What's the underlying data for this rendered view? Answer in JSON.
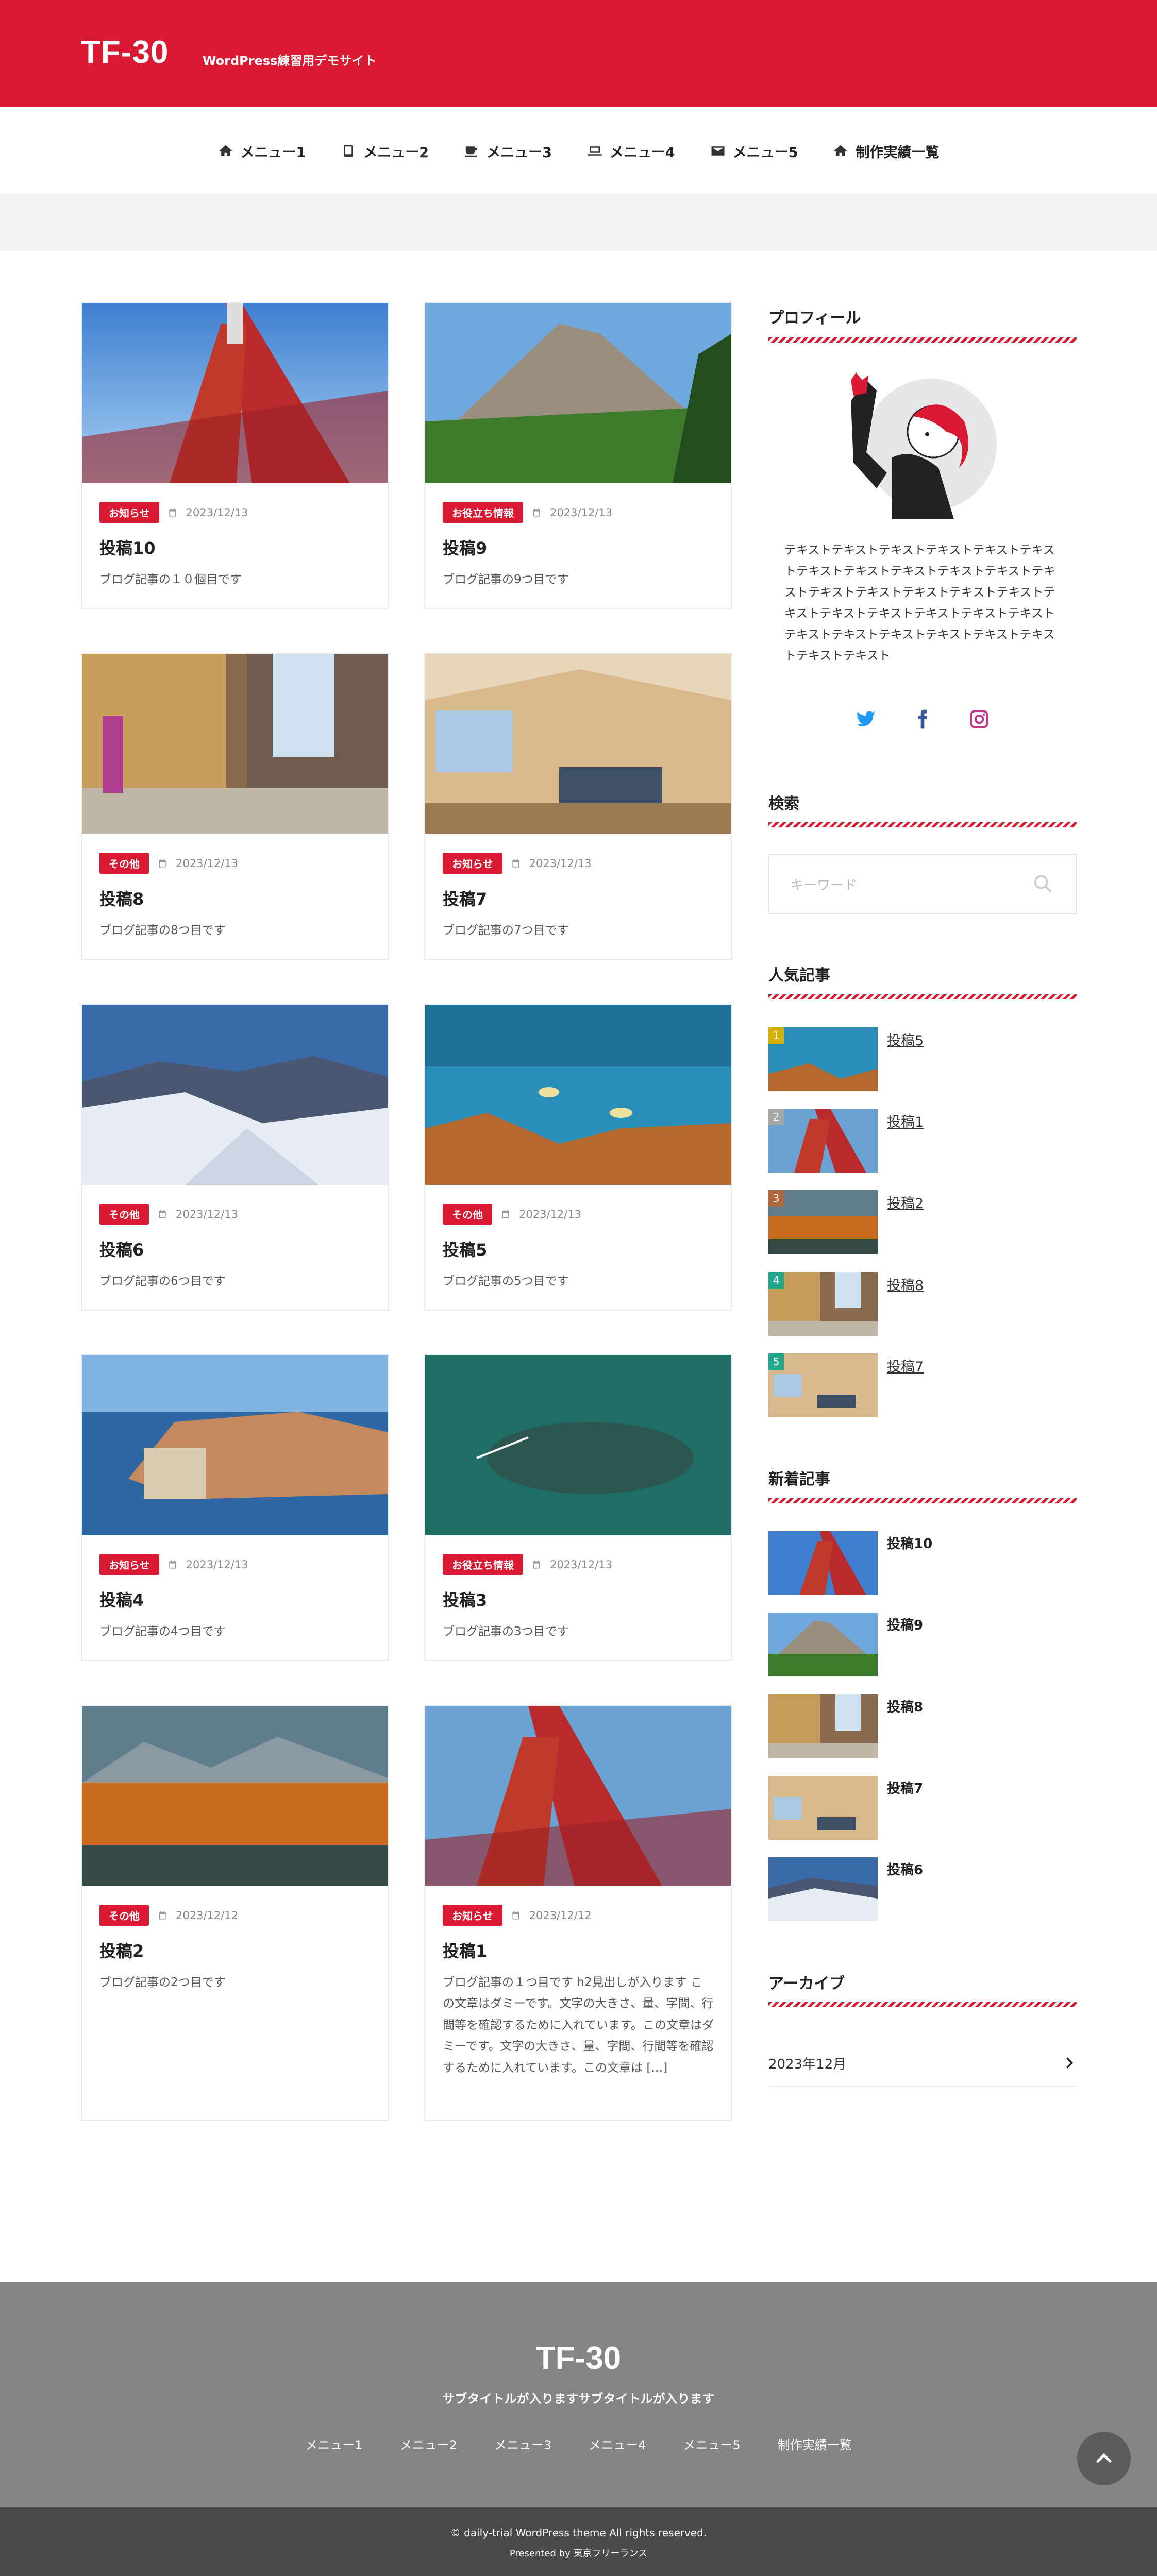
{
  "header": {
    "logo": "TF-30",
    "tagline": "WordPress練習用デモサイト"
  },
  "nav": [
    {
      "label": "メニュー1",
      "icon": "home-icon"
    },
    {
      "label": "メニュー2",
      "icon": "book-icon"
    },
    {
      "label": "メニュー3",
      "icon": "coffee-icon"
    },
    {
      "label": "メニュー4",
      "icon": "laptop-icon"
    },
    {
      "label": "メニュー5",
      "icon": "envelope-icon"
    },
    {
      "label": "制作実績一覧",
      "icon": "home-icon"
    }
  ],
  "posts": [
    {
      "category": "お知らせ",
      "date": "2023/12/13",
      "title": "投稿10",
      "excerpt": "ブログ記事の１０個目です",
      "image": "tokyo-tower"
    },
    {
      "category": "お役立ち情報",
      "date": "2023/12/13",
      "title": "投稿9",
      "excerpt": "ブログ記事の9つ目です",
      "image": "mountain"
    },
    {
      "category": "その他",
      "date": "2023/12/13",
      "title": "投稿8",
      "excerpt": "ブログ記事の8つ目です",
      "image": "street"
    },
    {
      "category": "お知らせ",
      "date": "2023/12/13",
      "title": "投稿7",
      "excerpt": "ブログ記事の7つ目です",
      "image": "living-room"
    },
    {
      "category": "その他",
      "date": "2023/12/13",
      "title": "投稿6",
      "excerpt": "ブログ記事の6つ目です",
      "image": "snow-mountain"
    },
    {
      "category": "その他",
      "date": "2023/12/13",
      "title": "投稿5",
      "excerpt": "ブログ記事の5つ目です",
      "image": "coral-reef"
    },
    {
      "category": "お知らせ",
      "date": "2023/12/13",
      "title": "投稿4",
      "excerpt": "ブログ記事の4つ目です",
      "image": "coastal-town"
    },
    {
      "category": "お役立ち情報",
      "date": "2023/12/13",
      "title": "投稿3",
      "excerpt": "ブログ記事の3つ目です",
      "image": "whale-boat"
    },
    {
      "category": "その他",
      "date": "2023/12/12",
      "title": "投稿2",
      "excerpt": "ブログ記事の2つ目です",
      "image": "autumn-lake"
    },
    {
      "category": "お知らせ",
      "date": "2023/12/12",
      "title": "投稿1",
      "excerpt": "ブログ記事の１つ目です h2見出しが入ります この文章はダミーです。文字の大きさ、量、字間、行間等を確認するために入れています。この文章はダミーです。文字の大きさ、量、字間、行間等を確認するために入れています。この文章は [&hellip;]",
      "image": "tokyo-tower"
    }
  ],
  "sidebar": {
    "profile_title": "プロフィール",
    "profile_text": "テキストテキストテキストテキストテキストテキストテキストテキストテキストテキストテキストテキストテキストテキストテキストテキストテキストテキストテキストテキストテキストテキストテキストテキストテキストテキストテキストテキストテキストテキストテキスト",
    "sns": [
      "twitter-icon",
      "facebook-icon",
      "instagram-icon"
    ],
    "search_title": "検索",
    "search_placeholder": "キーワード",
    "popular_title": "人気記事",
    "popular": [
      {
        "rank": "1",
        "title": "投稿5",
        "color": "#d4b000",
        "image": "coral-reef"
      },
      {
        "rank": "2",
        "title": "投稿1",
        "color": "#a7a7a7",
        "image": "tokyo-tower"
      },
      {
        "rank": "3",
        "title": "投稿2",
        "color": "#b2663b",
        "image": "autumn-lake"
      },
      {
        "rank": "4",
        "title": "投稿8",
        "color": "#23a88f",
        "image": "street"
      },
      {
        "rank": "5",
        "title": "投稿7",
        "color": "#23a88f",
        "image": "living-room"
      }
    ],
    "recent_title": "新着記事",
    "recent": [
      {
        "title": "投稿10",
        "image": "tokyo-tower"
      },
      {
        "title": "投稿9",
        "image": "mountain"
      },
      {
        "title": "投稿8",
        "image": "street"
      },
      {
        "title": "投稿7",
        "image": "living-room"
      },
      {
        "title": "投稿6",
        "image": "snow-mountain"
      }
    ],
    "archive_title": "アーカイブ",
    "archive_item": "2023年12月"
  },
  "footer": {
    "logo": "TF-30",
    "subtitle": "サブタイトルが入りますサブタイトルが入ります",
    "nav": [
      "メニュー1",
      "メニュー2",
      "メニュー3",
      "メニュー4",
      "メニュー5",
      "制作実績一覧"
    ],
    "copyright": "© daily-trial WordPress theme All rights reserved.",
    "presented": "Presented by 東京フリーランス"
  },
  "colors": {
    "brand": "#da1a32",
    "footer": "#858585",
    "footer_bottom": "#4a4a4a"
  }
}
